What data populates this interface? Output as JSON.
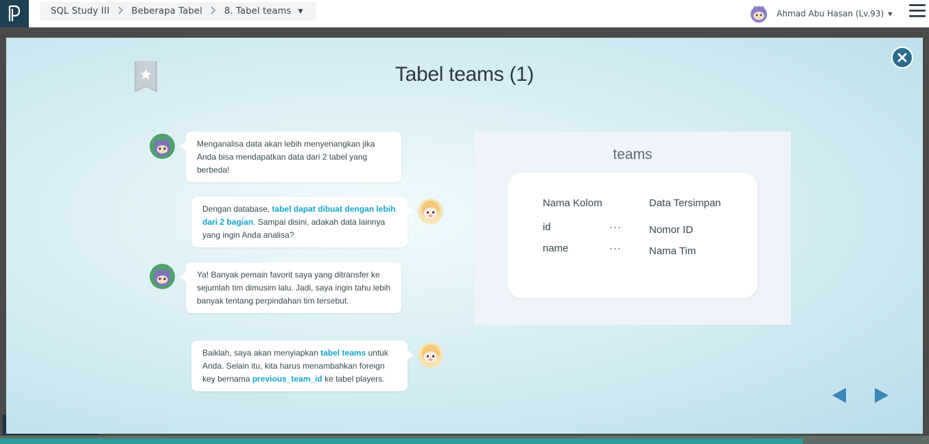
{
  "breadcrumb": {
    "items": [
      "SQL Study III",
      "Beberapa Tabel",
      "8. Tabel teams"
    ],
    "separator": ">"
  },
  "user": {
    "name": "Ahmad Abu Hasan (Lv.93)"
  },
  "modal": {
    "title": "Tabel teams (1)",
    "messages": [
      {
        "side": "left",
        "segments": [
          {
            "t": "Menganalisa data akan lebih menyenangkan jika Anda bisa mendapatkan data dari 2 tabel yang berbeda!",
            "hl": false
          }
        ]
      },
      {
        "side": "right",
        "segments": [
          {
            "t": "Dengan database, ",
            "hl": false
          },
          {
            "t": "tabel dapat dibuat dengan lebih dari 2 bagian",
            "hl": true
          },
          {
            "t": ". Sampai disini, adakah data lainnya yang ingin Anda analisa?",
            "hl": false
          }
        ]
      },
      {
        "side": "left",
        "segments": [
          {
            "t": "Ya! Banyak pemain favorit saya yang ditransfer ke sejumlah tim dimusim lalu. Jadi, saya ingin tahu lebih banyak tentang perpindahan tim tersebut.",
            "hl": false
          }
        ]
      },
      {
        "side": "right",
        "segments": [
          {
            "t": "Baiklah, saya akan menyiapkan ",
            "hl": false
          },
          {
            "t": "tabel teams",
            "hl": true
          },
          {
            "t": " untuk Anda. Selain itu, kita harus menambahkan foreign key bernama ",
            "hl": false
          },
          {
            "t": "previous_team_id",
            "hl": true
          },
          {
            "t": " ke tabel players.",
            "hl": false
          }
        ]
      }
    ],
    "table": {
      "name": "teams",
      "header_column": "Nama Kolom",
      "header_stored": "Data Tersimpan",
      "rows": [
        {
          "column": "id",
          "sep": "···",
          "stored": "Nomor ID"
        },
        {
          "column": "name",
          "sep": "···",
          "stored": "Nama Tim"
        }
      ]
    }
  },
  "colors": {
    "accent": "#16a3c9",
    "close": "#2a6d8c",
    "nav_arrow": "#3d86b8"
  },
  "icons": [
    "logo-icon",
    "bookmark-star-icon",
    "close-icon",
    "prev-arrow-icon",
    "next-arrow-icon",
    "chevron-right-icon",
    "caret-down-icon",
    "hamburger-menu-icon"
  ]
}
